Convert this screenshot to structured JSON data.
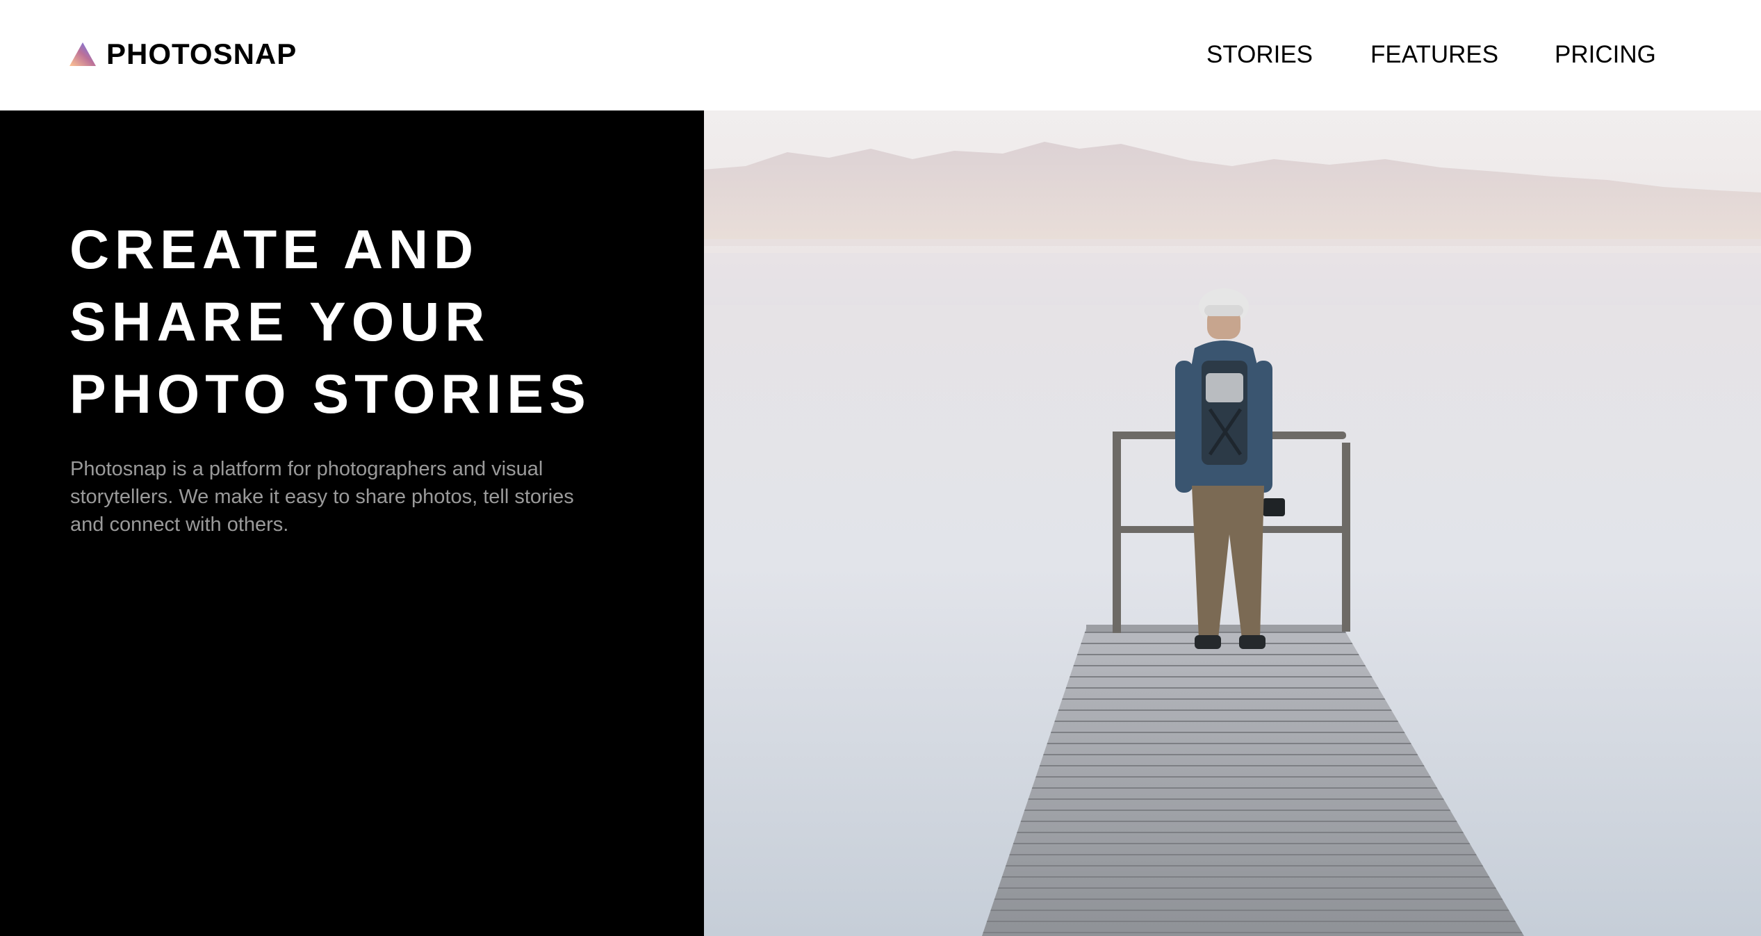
{
  "header": {
    "brand": {
      "name": "PHOTOSNAP",
      "icon": "triangle-logo-icon"
    },
    "nav": [
      {
        "label": "STORIES"
      },
      {
        "label": "FEATURES"
      },
      {
        "label": "PRICING"
      }
    ]
  },
  "hero": {
    "title_lines": [
      "CREATE AND",
      "SHARE YOUR",
      "PHOTO STORIES"
    ],
    "description_lines": [
      "Photosnap is a platform for photographers and visual",
      "storytellers. We make it easy to share photos, tell stories",
      "and connect with others."
    ],
    "image": "photographer-on-pier-image"
  },
  "colors": {
    "brand_gradient_start": "#ffc593",
    "brand_gradient_mid": "#bc7198",
    "brand_gradient_end": "#5a77ff",
    "hero_background": "#000000",
    "description_text": "#9a9a9a"
  }
}
